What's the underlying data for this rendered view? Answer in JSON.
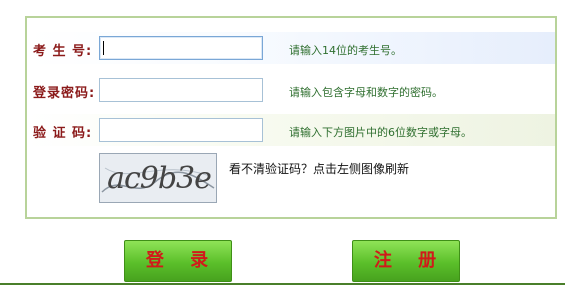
{
  "form": {
    "fields": [
      {
        "label": "考 生 号:",
        "value": "",
        "placeholder": "",
        "hint": "请输入14位的考生号。"
      },
      {
        "label": "登录密码:",
        "value": "",
        "placeholder": "",
        "hint": "请输入包含字母和数字的密码。"
      },
      {
        "label": "验 证 码:",
        "value": "",
        "placeholder": "",
        "hint": "请输入下方图片中的6位数字或字母。"
      }
    ],
    "captcha": {
      "image_text": "ac9b3e",
      "note": "看不清验证码？点击左侧图像刷新"
    }
  },
  "buttons": {
    "login": "登 录",
    "register": "注 册"
  },
  "colors": {
    "panel_border": "#b8d39a",
    "label": "#8b1a1a",
    "hint": "#2f6f2f",
    "button_green": "#5bbf2a",
    "button_text": "#d11a1a"
  }
}
